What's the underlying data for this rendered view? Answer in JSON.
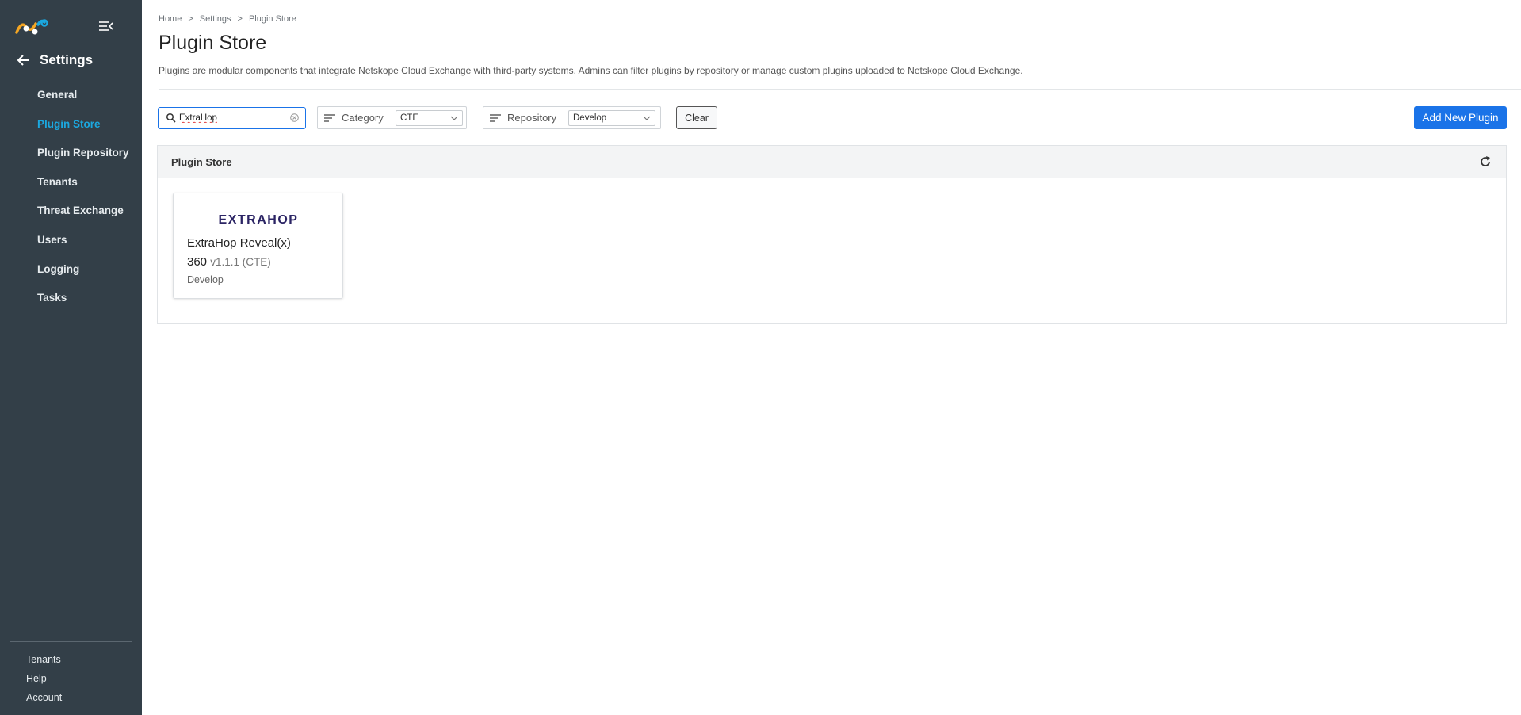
{
  "sidebar": {
    "title": "Settings",
    "items": [
      {
        "label": "General"
      },
      {
        "label": "Plugin Store"
      },
      {
        "label": "Plugin Repository"
      },
      {
        "label": "Tenants"
      },
      {
        "label": "Threat Exchange"
      },
      {
        "label": "Users"
      },
      {
        "label": "Logging"
      },
      {
        "label": "Tasks"
      }
    ],
    "active_item": "Plugin Store",
    "bottom_items": [
      {
        "label": "Tenants"
      },
      {
        "label": "Help"
      },
      {
        "label": "Account"
      }
    ]
  },
  "breadcrumb": {
    "items": [
      "Home",
      "Settings",
      "Plugin Store"
    ],
    "separator": ">"
  },
  "page": {
    "title": "Plugin Store",
    "description": "Plugins are modular components that integrate Netskope Cloud Exchange with third-party systems. Admins can filter plugins by repository or manage custom plugins uploaded to Netskope Cloud Exchange."
  },
  "filters": {
    "search_value": "ExtraHop",
    "category_label": "Category",
    "category_value": "CTE",
    "repository_label": "Repository",
    "repository_value": "Develop",
    "clear_label": "Clear",
    "add_label": "Add New Plugin"
  },
  "panel": {
    "title": "Plugin Store",
    "cards": [
      {
        "logo_text": "EXTRAHOP",
        "name": "ExtraHop Reveal(x) 360",
        "version": "v1.1.1 (CTE)",
        "repository": "Develop"
      }
    ]
  },
  "colors": {
    "sidebar_bg": "#333f48",
    "active_nav": "#1ba8e0",
    "primary": "#1a73e8"
  },
  "icons": [
    "app-logo-icon",
    "collapse-menu-icon",
    "back-arrow-icon",
    "search-icon",
    "clear-input-icon",
    "filter-sort-icon",
    "chevron-down-icon",
    "refresh-icon"
  ]
}
